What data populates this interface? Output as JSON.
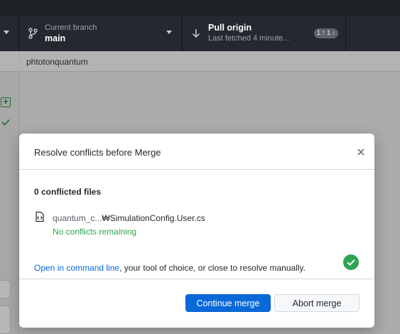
{
  "toolbar": {
    "branch": {
      "label": "Current branch",
      "value": "main",
      "icon": "branch-icon"
    },
    "pull": {
      "label": "Pull origin",
      "sublabel": "Last fetched 4 minute...",
      "icon": "arrow-down-icon",
      "incoming": "1",
      "outgoing": "1"
    }
  },
  "repo_path": "phtotonquantum",
  "dialog": {
    "title": "Resolve conflicts before Merge",
    "conflict_count": "0 conflicted files",
    "file": {
      "name_prefix": "quantum_c...",
      "name_suffix": "₩SimulationConfig.User.cs",
      "status": "No conflicts remaining",
      "icon": "file-code-icon",
      "status_icon": "check-circle-icon"
    },
    "help": {
      "link": "Open in command line",
      "rest": ", your tool of choice, or close to resolve manually."
    },
    "buttons": {
      "continue": "Continue merge",
      "abort": "Abort merge"
    }
  },
  "colors": {
    "primary": "#0969da",
    "success": "#2da44e",
    "toolbar_bg": "#24292f"
  }
}
